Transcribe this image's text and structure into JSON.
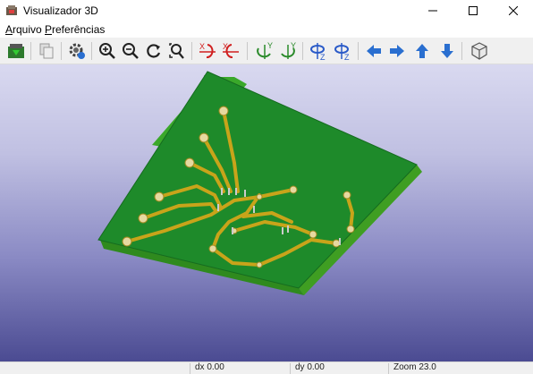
{
  "window": {
    "title": "Visualizador 3D",
    "controls": [
      "minimize",
      "maximize",
      "close"
    ]
  },
  "menu": {
    "arquivo": {
      "label": "Arquivo",
      "accel": "A",
      "rest": "rquivo"
    },
    "preferencias": {
      "label": "Preferências",
      "accel": "P",
      "rest": "referências"
    }
  },
  "toolbar": {
    "buttons": [
      "reload-board-icon",
      "copy-image-icon",
      "settings-icon",
      "zoom-in-icon",
      "zoom-out-icon",
      "zoom-refresh-icon",
      "zoom-fit-icon",
      "rotate-x-cw-icon",
      "rotate-x-ccw-icon",
      "rotate-y-cw-icon",
      "rotate-y-ccw-icon",
      "rotate-z-cw-icon",
      "rotate-z-ccw-icon",
      "move-left-icon",
      "move-right-icon",
      "move-up-icon",
      "move-down-icon",
      "ortho-toggle-icon"
    ]
  },
  "viewport": {
    "content": "3d-pcb-render",
    "colors": {
      "board": "#1e8a2a",
      "board_edge": "#4fb82a",
      "copper": "#c8a41a",
      "pad": "#e6d9a0",
      "background_top": "#d9d9f0",
      "background_bottom": "#4b4b92"
    }
  },
  "status": {
    "dx": "dx 0.00",
    "dy": "dy 0.00",
    "zoom": "Zoom 23.0"
  }
}
